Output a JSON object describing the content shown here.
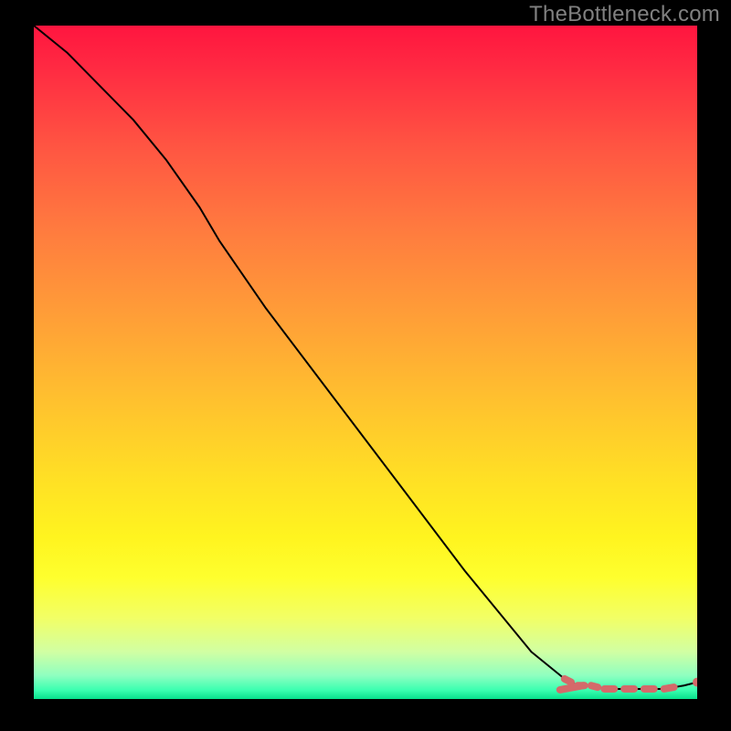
{
  "watermark": "TheBottleneck.com",
  "chart_data": {
    "type": "line",
    "title": "",
    "xlabel": "",
    "ylabel": "",
    "xlim": [
      0,
      100
    ],
    "ylim": [
      0,
      100
    ],
    "grid": false,
    "legend": false,
    "axes_visible": false,
    "background_gradient": {
      "orientation": "vertical",
      "stops": [
        {
          "pos": 0.0,
          "color": "#ff153f"
        },
        {
          "pos": 0.18,
          "color": "#ff5542"
        },
        {
          "pos": 0.42,
          "color": "#ff9b38"
        },
        {
          "pos": 0.67,
          "color": "#ffdf25"
        },
        {
          "pos": 0.82,
          "color": "#feff2e"
        },
        {
          "pos": 0.93,
          "color": "#d1ffa3"
        },
        {
          "pos": 1.0,
          "color": "#08e08c"
        }
      ]
    },
    "series": [
      {
        "name": "bottleneck-curve",
        "type": "line",
        "color": "#000000",
        "x": [
          0,
          5,
          10,
          15,
          20,
          25,
          28,
          35,
          45,
          55,
          65,
          75,
          80,
          82,
          84,
          86,
          89,
          92,
          95,
          98,
          100
        ],
        "y": [
          100,
          96,
          91,
          86,
          80,
          73,
          68,
          58,
          45,
          32,
          19,
          7,
          3,
          2,
          2,
          1.5,
          1.5,
          1.5,
          1.5,
          2,
          2.5
        ]
      },
      {
        "name": "highlight-band",
        "type": "line",
        "color": "#d46a6a",
        "stroke_width": 8,
        "x": [
          80,
          82,
          84,
          86,
          89,
          92,
          95,
          98
        ],
        "y": [
          3,
          2,
          2,
          1.5,
          1.5,
          1.5,
          1.5,
          2
        ]
      },
      {
        "name": "end-marker",
        "type": "scatter",
        "color": "#d46a6a",
        "x": [
          100
        ],
        "y": [
          2.5
        ]
      }
    ]
  }
}
